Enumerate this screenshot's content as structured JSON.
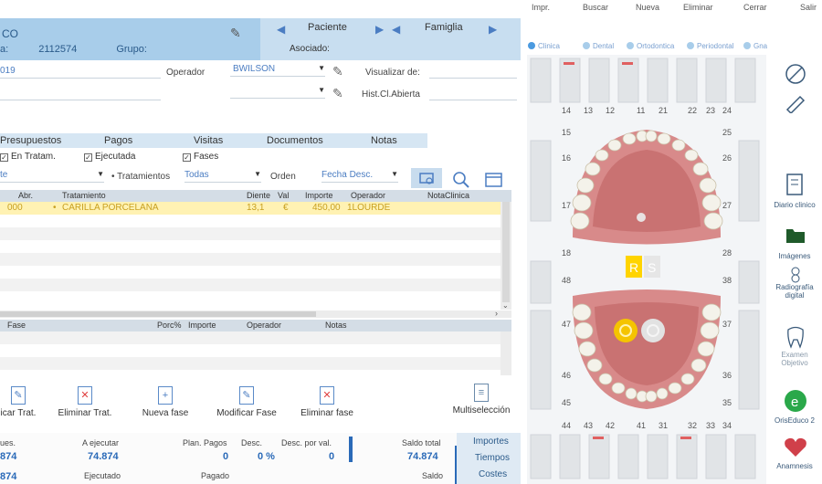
{
  "toolbar": {
    "items": [
      "Impr.",
      "Buscar",
      "Nueva",
      "Eliminar",
      "Cerrar",
      "Salir"
    ]
  },
  "header": {
    "title": "CO",
    "id_label": "a:",
    "id_value": "2112574",
    "grupo_label": "Grupo:",
    "asociado_label": "Asociado:",
    "tab_paciente": "Paciente",
    "tab_famiglia": "Famiglia"
  },
  "form": {
    "date_value": "019",
    "operador_label": "Operador",
    "operador_value": "BWILSON",
    "visualizar_label": "Visualizar de:",
    "hist_label": "Hist.Cl.Abierta"
  },
  "subtabs": [
    "Presupuestos",
    "Pagos",
    "Visitas",
    "Documentos",
    "Notas"
  ],
  "filters": {
    "en_tratam": "En Tratam.",
    "ejecutada": "Ejecutada",
    "fases": "Fases",
    "left_value": "te",
    "tratamientos_label": "Tratamientos",
    "tratamientos_value": "Todas",
    "orden_label": "Orden",
    "orden_value": "Fecha Desc."
  },
  "table": {
    "headers": [
      "Abr.",
      "Tratamiento",
      "Diente",
      "Val",
      "Importe",
      "Operador",
      "NotaClinica"
    ],
    "rows": [
      {
        "abr": "000",
        "tratamiento": "CARILLA PORCELANA",
        "diente": "13,1",
        "val": "€",
        "importe": "450,00",
        "operador": "1LOURDE"
      }
    ]
  },
  "table2": {
    "headers": [
      "Fase",
      "Porc%",
      "Importe",
      "Operador",
      "Notas"
    ]
  },
  "actions": {
    "modificar_trat": "icar Trat.",
    "eliminar_trat": "Eliminar Trat.",
    "nueva_fase": "Nueva fase",
    "modificar_fase": "Modificar Fase",
    "eliminar_fase": "Eliminar fase",
    "multiseleccion": "Multiselección"
  },
  "totals": {
    "pues_label": "ues.",
    "pues_value": "874",
    "a_ejecutar_label": "A ejecutar",
    "a_ejecutar_value": "74.874",
    "plan_pagos_label": "Plan. Pagos",
    "plan_pagos_value": "0",
    "desc_label": "Desc.",
    "desc_value": "0 %",
    "desc_val_label": "Desc. por val.",
    "desc_val_value": "0",
    "saldo_total_label": "Saldo total",
    "saldo_total_value": "74.874",
    "ejecutado_label": "Ejecutado",
    "pagado_label": "Pagado",
    "saldo_label": "Saldo",
    "row3_left": "874"
  },
  "side_buttons": [
    "Importes",
    "Tiempos",
    "Costes"
  ],
  "odontogram": {
    "tabs": [
      "Clinica",
      "Dental",
      "Ortodontica",
      "Periodontal",
      "Gnatologico"
    ],
    "upper_numbers": [
      "14",
      "13",
      "12",
      "11",
      "21",
      "22",
      "23",
      "24"
    ],
    "lower_numbers": [
      "44",
      "43",
      "42",
      "41",
      "31",
      "32",
      "33",
      "34"
    ],
    "left_side": [
      "15",
      "16",
      "17",
      "18",
      "48",
      "47",
      "46",
      "45"
    ],
    "right_side": [
      "25",
      "26",
      "27",
      "28",
      "38",
      "37",
      "36",
      "35"
    ],
    "toggle_r": "R",
    "toggle_s": "S"
  },
  "right_panel": [
    "Diario clinico",
    "Imágenes",
    "Radiografía digital",
    "Examen Objetivo",
    "OrisEduco 2",
    "Anamnesis"
  ]
}
